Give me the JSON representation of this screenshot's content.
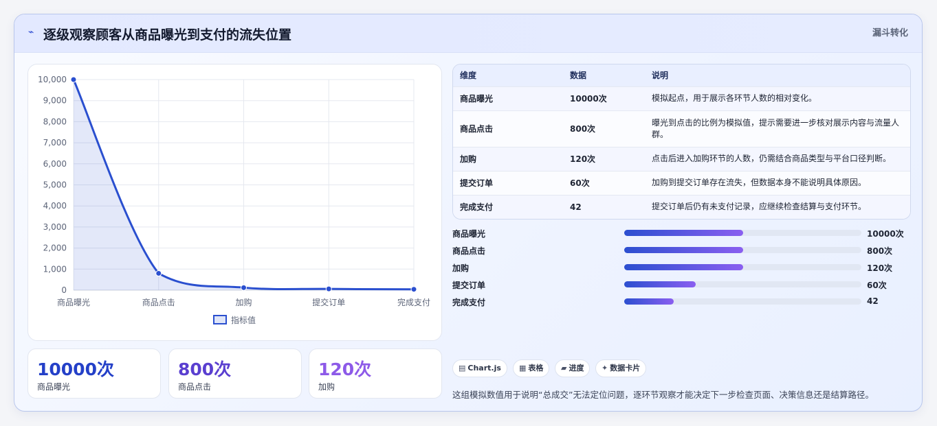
{
  "header": {
    "title": "逐级观察顾客从商品曝光到支付的流失位置",
    "tag": "漏斗转化",
    "icon": "bolt-icon"
  },
  "chart_data": {
    "type": "line",
    "categories": [
      "商品曝光",
      "商品点击",
      "加购",
      "提交订单",
      "完成支付"
    ],
    "series": [
      {
        "name": "指标值",
        "values": [
          10000,
          800,
          120,
          60,
          42
        ]
      }
    ],
    "ylim": [
      0,
      10000
    ],
    "yticks": [
      "0",
      "1,000",
      "2,000",
      "3,000",
      "4,000",
      "5,000",
      "6,000",
      "7,000",
      "8,000",
      "9,000",
      "10,000"
    ],
    "grid": true,
    "legend": "bottom",
    "fill": true,
    "color": "#2a4fcf"
  },
  "kpis": [
    {
      "value": "10000次",
      "label": "商品曝光",
      "color": "#2440c8"
    },
    {
      "value": "800次",
      "label": "商品点击",
      "color": "#5a3fd0"
    },
    {
      "value": "120次",
      "label": "加购",
      "color": "#8d5ae8"
    }
  ],
  "table": {
    "headers": [
      "维度",
      "数据",
      "说明"
    ],
    "rows": [
      [
        "商品曝光",
        "10000次",
        "模拟起点，用于展示各环节人数的相对变化。"
      ],
      [
        "商品点击",
        "800次",
        "曝光到点击的比例为模拟值，提示需要进一步核对展示内容与流量人群。"
      ],
      [
        "加购",
        "120次",
        "点击后进入加购环节的人数，仍需结合商品类型与平台口径判断。"
      ],
      [
        "提交订单",
        "60次",
        "加购到提交订单存在流失，但数据本身不能说明具体原因。"
      ],
      [
        "完成支付",
        "42",
        "提交订单后仍有未支付记录，应继续检查结算与支付环节。"
      ]
    ]
  },
  "progress": [
    {
      "label": "商品曝光",
      "value": "10000次",
      "fraction": 0.5
    },
    {
      "label": "商品点击",
      "value": "800次",
      "fraction": 0.5
    },
    {
      "label": "加购",
      "value": "120次",
      "fraction": 0.5
    },
    {
      "label": "提交订单",
      "value": "60次",
      "fraction": 0.3
    },
    {
      "label": "完成支付",
      "value": "42",
      "fraction": 0.21
    }
  ],
  "pills": [
    {
      "icon": "▤",
      "label": "Chart.js"
    },
    {
      "icon": "▦",
      "label": "表格"
    },
    {
      "icon": "▰",
      "label": "进度"
    },
    {
      "icon": "✦",
      "label": "数据卡片"
    }
  ],
  "footnote": "这组模拟数值用于说明“总成交”无法定位问题，逐环节观察才能决定下一步检查页面、决策信息还是结算路径。"
}
